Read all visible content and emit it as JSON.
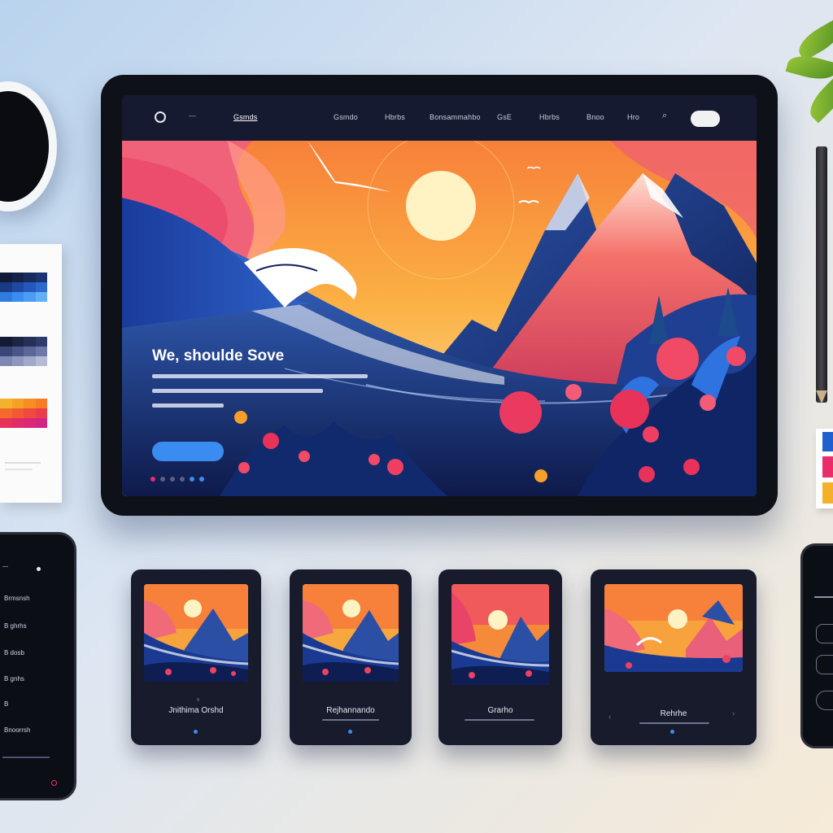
{
  "nav": {
    "items": [
      "Gsmds",
      "Gsmdo",
      "Hbrbs",
      "Bonsammahbo",
      "GsE",
      "Hbrbs",
      "Bnoo",
      "Hro"
    ],
    "active_index": 0
  },
  "hero": {
    "title": "We, shoulde Sove",
    "slide_count": 6,
    "active_slide": 4
  },
  "cards": [
    {
      "title": "Jnithima Orshd"
    },
    {
      "title": "Rejhannando"
    },
    {
      "title": "Grarho"
    },
    {
      "title": "Rehrhe"
    }
  ],
  "phone_left": {
    "items": [
      "Brmsnsh",
      "B ghrhs",
      "B dosb",
      "B gnhs",
      "B",
      "Bnoorrsh"
    ]
  },
  "colors": {
    "accent": "#3a8cf0",
    "tablet_bezel": "#0e1118",
    "sun": "#fff3c4"
  }
}
